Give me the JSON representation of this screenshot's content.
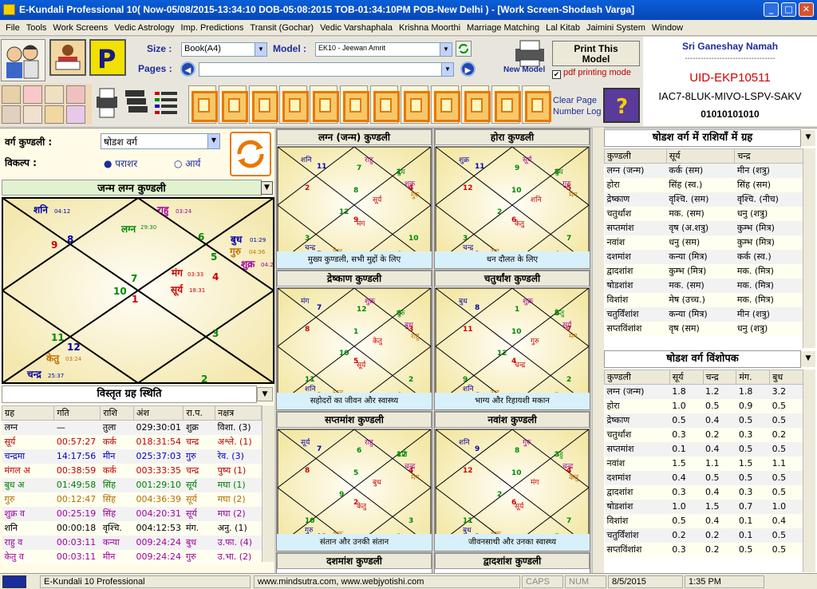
{
  "window": {
    "title": "E-Kundali Professional 10( Now-05/08/2015-13:34:10 DOB-05:08:2015 TOB-01:34:10PM POB-New Delhi ) - [Work Screen-Shodash Varga]"
  },
  "menu": [
    "File",
    "Tools",
    "Work Screens",
    "Vedic Astrology",
    "Imp. Predictions",
    "Transit (Gochar)",
    "Vedic Varshaphala",
    "Krishna Moorthi",
    "Marriage Matching",
    "Lal Kitab",
    "Jaimini System",
    "Window"
  ],
  "toolbar": {
    "size_label": "Size :",
    "size_value": "Book(A4)",
    "model_label": "Model :",
    "model_value": "EK10 - Jeewan Amrit",
    "pages_label": "Pages :",
    "pages_value": "",
    "new_model": "New Model",
    "print_line1": "Print This",
    "print_line2": "Model",
    "pdf_mode": "pdf printing mode",
    "clear_page": "Clear Page",
    "number_log": "Number Log"
  },
  "info": {
    "greeting": "Sri Ganeshay Namah",
    "dashes": "----------------------------------",
    "uid": "UID-EKP10511",
    "code": "IAC7-8LUK-MIVO-LSPV-SAKV",
    "serial": "01010101010"
  },
  "left": {
    "varga_label": "वर्ग कुण्डली :",
    "varga_value": "षोडश वर्ग",
    "vikalp_label": "विकल्प :",
    "opt1": "पराशर",
    "opt2": "आर्य",
    "main_title": "जन्म लग्न कुण्डली",
    "planet_title": "विस्तृत ग्रह स्थिति"
  },
  "main_chart": {
    "houses": [
      "1",
      "2",
      "3",
      "4",
      "5",
      "6",
      "7",
      "8",
      "9",
      "10",
      "11",
      "12"
    ],
    "planets": [
      "शनि",
      "04:12",
      "राहु",
      "03:24",
      "लग्न",
      "29:30",
      "बुध",
      "01:29",
      "गुरु",
      "04:36",
      "शुक्र",
      "04:2",
      "मंग",
      "03:33",
      "सूर्य",
      "18:31",
      "केतु",
      "03:24",
      "चन्द्र",
      "25:37"
    ]
  },
  "planet_table": {
    "headers": [
      "ग्रह",
      "गति",
      "राशि",
      "अंश",
      "रा.प.",
      "नक्षत्र"
    ],
    "rows": [
      [
        "लग्न",
        "—",
        "तुला",
        "029:30:01",
        "शुक्र",
        "विशा. (3)"
      ],
      [
        "सूर्य",
        "00:57:27",
        "कर्क",
        "018:31:54",
        "चन्द्र",
        "अश्ले. (1)"
      ],
      [
        "चन्द्रमा",
        "14:17:56",
        "मीन",
        "025:37:03",
        "गुरु",
        "रेव. (3)"
      ],
      [
        "मंगल अ",
        "00:38:59",
        "कर्क",
        "003:33:35",
        "चन्द्र",
        "पुष्य (1)"
      ],
      [
        "बुध अ",
        "01:49:58",
        "सिंह",
        "001:29:10",
        "सूर्य",
        "मघा (1)"
      ],
      [
        "गुरु",
        "00:12:47",
        "सिंह",
        "004:36:39",
        "सूर्य",
        "मघा (2)"
      ],
      [
        "शुक्र व",
        "00:25:19",
        "सिंह",
        "004:20:31",
        "सूर्य",
        "मघा (2)"
      ],
      [
        "शनि",
        "00:00:18",
        "वृश्चि.",
        "004:12:53",
        "मंग.",
        "अनु. (1)"
      ],
      [
        "राहु व",
        "00:03:11",
        "कन्या",
        "009:24:24",
        "बुध",
        "उ.फा. (4)"
      ],
      [
        "केतु व",
        "00:03:11",
        "मीन",
        "009:24:24",
        "गुरु",
        "उ.भा. (2)"
      ]
    ]
  },
  "kundalis": [
    {
      "title": "लग्न (जन्म) कुण्डली",
      "caption": "मुख्य कुण्डली, सभी मुद्दों के लिए",
      "houses": [
        "9",
        "6",
        "10",
        "4",
        "1",
        "7",
        "8",
        "11",
        "2",
        "12",
        "3",
        "5"
      ],
      "planets": [
        "शनि",
        "राहु",
        "बुध",
        "शुक्र",
        "गुरु",
        "सूर्य",
        "मंग",
        "चन्द्र",
        "केतु"
      ]
    },
    {
      "title": "होरा कुण्डली",
      "caption": "धन दौलत के लिए",
      "houses": [
        "6",
        "4",
        "7",
        "5",
        "8",
        "9",
        "10",
        "11",
        "12",
        "2",
        "3",
        "1"
      ],
      "planets": [
        "शुक्र",
        "सूर्य",
        "बुध",
        "गुरु",
        "मंग",
        "शनि",
        "केतु",
        "चन्द्र",
        "राहु"
      ]
    },
    {
      "title": "द्रेष्काण कुण्डली",
      "caption": "सहोदरों का जीवन और स्वास्थ्य",
      "houses": [
        "5",
        "4",
        "2",
        "3",
        "6",
        "12",
        "1",
        "7",
        "8",
        "10",
        "11",
        "9"
      ],
      "planets": [
        "मंग",
        "शुक्र",
        "गुरु",
        "बुध",
        "राहु",
        "केतु",
        "सूर्य",
        "शनि",
        "चन्द्र"
      ]
    },
    {
      "title": "चतुर्थांश कुण्डली",
      "caption": "भाग्य और रिहायशी मकान",
      "houses": [
        "4",
        "3",
        "2",
        "7",
        "5",
        "1",
        "10",
        "8",
        "11",
        "12",
        "9",
        "6"
      ],
      "planets": [
        "बुध",
        "शुक्र",
        "केतु",
        "सूर्य",
        "मंग",
        "गुरु",
        "चन्द्र",
        "शनि",
        "राहु"
      ]
    },
    {
      "title": "सप्तमांश कुण्डली",
      "caption": "संतान और उनकी संतान",
      "houses": [
        "2",
        "1",
        "3",
        "4",
        "12",
        "6",
        "5",
        "7",
        "8",
        "9",
        "10",
        "11"
      ],
      "planets": [
        "सूर्य",
        "राहु",
        "शनि",
        "चन्द्र",
        "मंग",
        "बुध",
        "केतु",
        "गुरु",
        "शुक्र"
      ]
    },
    {
      "title": "नवांश कुण्डली",
      "caption": "जीवनसाथी और उनका स्वास्थ्य",
      "houses": [
        "6",
        "5",
        "7",
        "4",
        "3",
        "8",
        "10",
        "9",
        "12",
        "2",
        "11",
        "1"
      ],
      "planets": [
        "शनि",
        "गुरु",
        "राहु",
        "चन्द्र",
        "केतु",
        "मंग",
        "सूर्य",
        "बुध",
        "शुक्र"
      ]
    },
    {
      "title": "दशमांश कुण्डली",
      "caption": "",
      "houses": [],
      "planets": []
    },
    {
      "title": "द्वादशांश कुण्डली",
      "caption": "",
      "houses": [],
      "planets": []
    }
  ],
  "varga_rashi": {
    "title": "षोडश वर्ग में राशियाँ में ग्रह",
    "headers": [
      "कुण्डली",
      "सूर्य",
      "चन्द्र"
    ],
    "rows": [
      [
        "लग्न (जन्म)",
        "कर्क (सम)",
        "मीन (शत्रु)"
      ],
      [
        "होरा",
        "सिंह (स्व.)",
        "सिंह (सम)"
      ],
      [
        "द्रेष्काण",
        "वृश्चि. (सम)",
        "वृश्चि. (नीच)"
      ],
      [
        "चतुर्थांश",
        "मक. (सम)",
        "धनु (शत्रु)"
      ],
      [
        "सप्तमांश",
        "वृष (अ.शत्रु)",
        "कुम्भ (मित्र)"
      ],
      [
        "नवांश",
        "धनु (सम)",
        "कुम्भ (मित्र)"
      ],
      [
        "दशमांश",
        "कन्या (मित्र)",
        "कर्क (स्व.)"
      ],
      [
        "द्वादशांश",
        "कुम्भ (मित्र)",
        "मक. (मित्र)"
      ],
      [
        "षोडशांश",
        "मक. (सम)",
        "मक. (मित्र)"
      ],
      [
        "विशांश",
        "मेष (उच्च.)",
        "मक. (मित्र)"
      ],
      [
        "चतुर्विंशांश",
        "कन्या (मित्र)",
        "मीन (शत्रु)"
      ],
      [
        "सप्तविंशांश",
        "वृष (सम)",
        "धनु (शत्रु)"
      ]
    ]
  },
  "varga_vishopak": {
    "title": "षोडश वर्ग विंशोपक",
    "headers": [
      "कुण्डली",
      "सूर्य",
      "चन्द्र",
      "मंग.",
      "बुध"
    ],
    "rows": [
      [
        "लग्न (जन्म)",
        "1.8",
        "1.2",
        "1.8",
        "3.2"
      ],
      [
        "होरा",
        "1.0",
        "0.5",
        "0.9",
        "0.5"
      ],
      [
        "द्रेष्काण",
        "0.5",
        "0.4",
        "0.5",
        "0.5"
      ],
      [
        "चतुर्थांश",
        "0.3",
        "0.2",
        "0.3",
        "0.2"
      ],
      [
        "सप्तमांश",
        "0.1",
        "0.4",
        "0.5",
        "0.5"
      ],
      [
        "नवांश",
        "1.5",
        "1.1",
        "1.5",
        "1.1"
      ],
      [
        "दशमांश",
        "0.4",
        "0.5",
        "0.5",
        "0.5"
      ],
      [
        "द्वादशांश",
        "0.3",
        "0.4",
        "0.3",
        "0.5"
      ],
      [
        "षोडशांश",
        "1.0",
        "1.5",
        "0.7",
        "1.0"
      ],
      [
        "विशांश",
        "0.5",
        "0.4",
        "0.1",
        "0.4"
      ],
      [
        "चतुर्विंशांश",
        "0.2",
        "0.2",
        "0.1",
        "0.5"
      ],
      [
        "सप्तविंशांश",
        "0.3",
        "0.2",
        "0.5",
        "0.5"
      ]
    ]
  },
  "status": {
    "app": "E-Kundali 10 Professional",
    "web": "www.mindsutra.com, www.webjyotishi.com",
    "caps": "CAPS",
    "num": "NUM",
    "date": "8/5/2015",
    "time": "1:35 PM"
  }
}
